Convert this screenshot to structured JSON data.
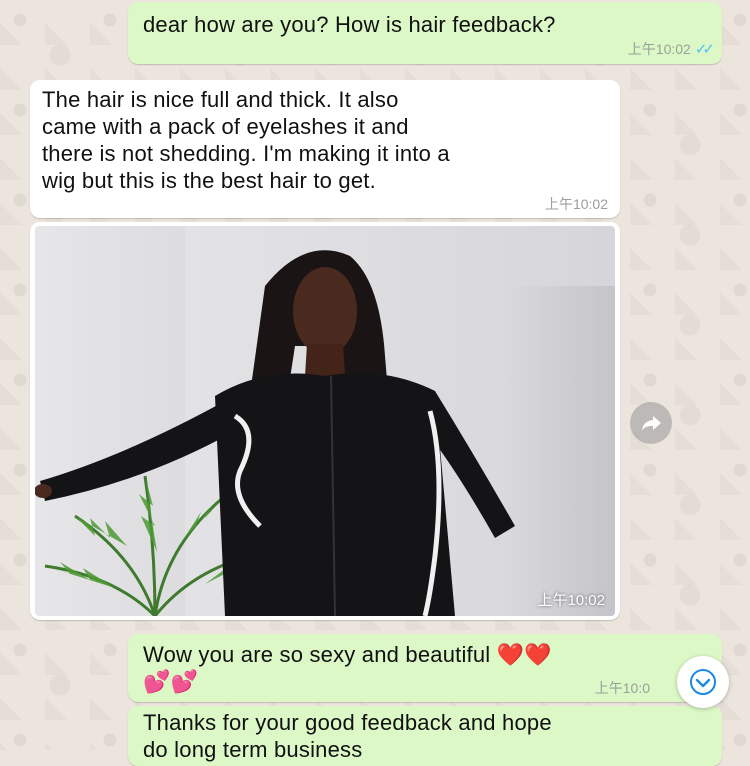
{
  "messages": [
    {
      "id": "m1",
      "direction": "outgoing",
      "text": "dear how are you? How is hair feedback?",
      "time": "上午10:02",
      "status": "read"
    },
    {
      "id": "m2",
      "direction": "incoming",
      "lines": [
        "The hair is nice full and thick. It also",
        "came with a pack of eyelashes it and",
        "there is not shedding. I'm making it into a",
        "wig but this is the best hair to get."
      ],
      "time": "上午10:02"
    },
    {
      "id": "m3",
      "direction": "incoming",
      "type": "image",
      "time": "上午10:02"
    },
    {
      "id": "m4",
      "direction": "outgoing",
      "text": "Wow you are so sexy and beautiful",
      "emoji_line1": "❤️❤️",
      "emoji_line2": "💕💕",
      "time": "上午10:0"
    },
    {
      "id": "m5",
      "direction": "outgoing",
      "lines": [
        "Thanks for your good feedback and hope",
        "do long term business"
      ]
    }
  ],
  "icons": {
    "share": "forward-arrow-icon",
    "scroll": "chevron-down-icon",
    "read_receipt": "double-check-icon"
  },
  "colors": {
    "outgoing": "#dcf8c6",
    "incoming": "#ffffff",
    "ticks": "#4fc3f7",
    "scroll_chevron": "#1e88e5"
  }
}
